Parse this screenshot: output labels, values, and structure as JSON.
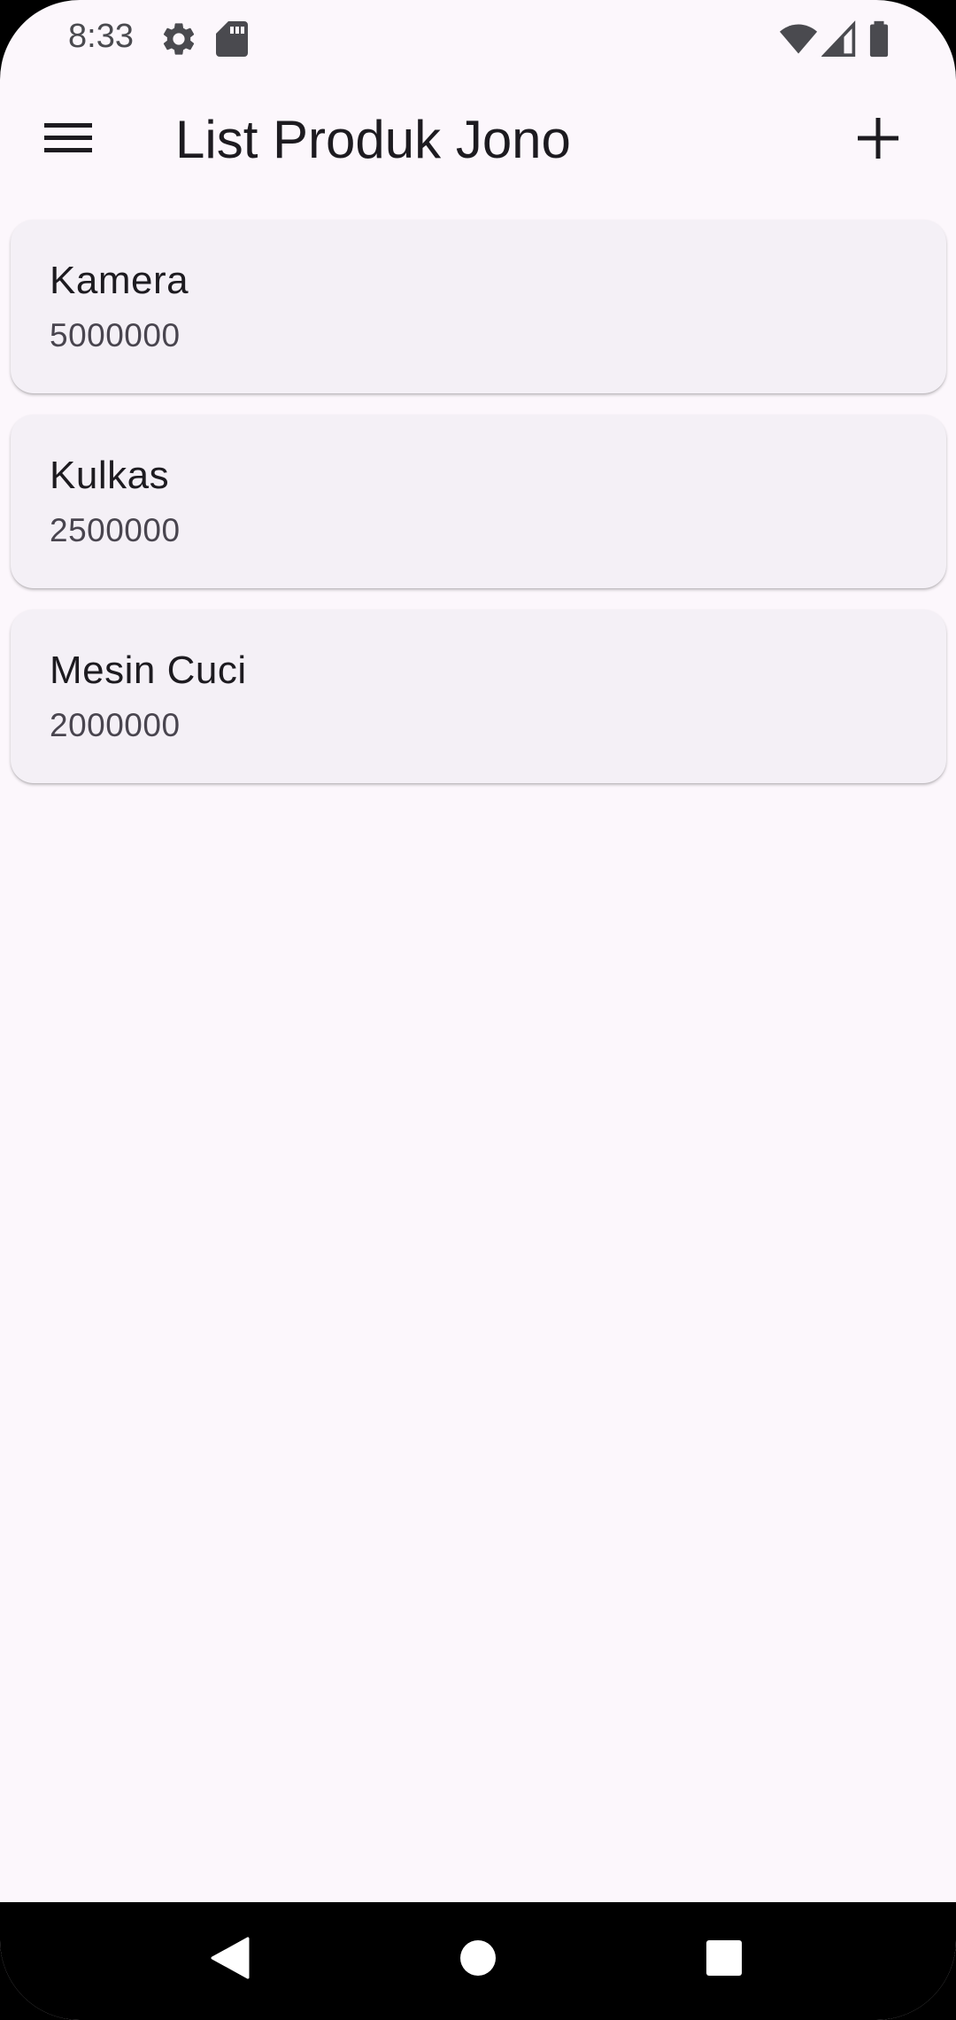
{
  "status_bar": {
    "time": "8:33",
    "left_icons": [
      "settings-icon",
      "sd-card-icon"
    ],
    "right_icons": [
      "wifi-icon",
      "signal-icon",
      "battery-icon"
    ]
  },
  "app_bar": {
    "title": "List Produk Jono",
    "menu_icon": "menu-icon",
    "add_icon": "add-icon"
  },
  "products": [
    {
      "name": "Kamera",
      "price": "5000000"
    },
    {
      "name": "Kulkas",
      "price": "2500000"
    },
    {
      "name": "Mesin Cuci",
      "price": "2000000"
    }
  ],
  "nav_bar": {
    "buttons": [
      "back-icon",
      "home-icon",
      "recents-icon"
    ]
  },
  "colors": {
    "background": "#fcf7fc",
    "card": "#f4f0f6",
    "text_primary": "#1d1b20",
    "text_secondary": "#49454f"
  }
}
